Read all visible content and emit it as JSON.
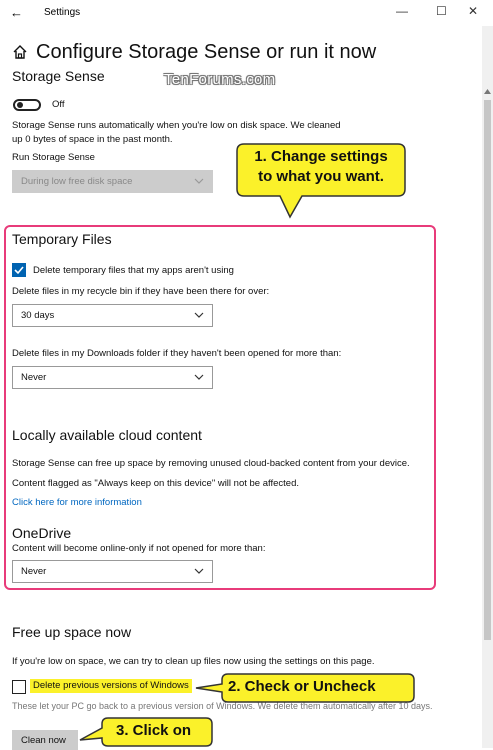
{
  "window": {
    "title": "Settings",
    "back_glyph": "←",
    "minimize_glyph": "—",
    "maximize_glyph": "☐",
    "close_glyph": "✕"
  },
  "header": {
    "title": "Configure Storage Sense or run it now",
    "watermark": "TenForums.com"
  },
  "storage_sense": {
    "heading": "Storage Sense",
    "toggle_state": "Off",
    "description": "Storage Sense runs automatically when you're low on disk space. We cleaned up 0 bytes of space in the past month.",
    "run_label": "Run Storage Sense",
    "run_value": "During low free disk space"
  },
  "temp_files": {
    "heading": "Temporary Files",
    "delete_temp_label": "Delete temporary files that my apps aren't using",
    "delete_temp_checked": true,
    "recycle_label": "Delete files in my recycle bin if they have been there for over:",
    "recycle_value": "30 days",
    "downloads_label": "Delete files in my Downloads folder if they haven't been opened for more than:",
    "downloads_value": "Never"
  },
  "cloud": {
    "heading": "Locally available cloud content",
    "desc1": "Storage Sense can free up space by removing unused cloud-backed content from your device.",
    "desc2": "Content flagged as \"Always keep on this device\" will not be affected.",
    "link": "Click here for more information",
    "onedrive_heading": "OneDrive",
    "onedrive_label": "Content will become online-only if not opened for more than:",
    "onedrive_value": "Never"
  },
  "free_up": {
    "heading": "Free up space now",
    "desc": "If you're low on space, we can try to clean up files now using the settings on this page.",
    "prev_versions_label": "Delete previous versions of Windows",
    "prev_versions_checked": false,
    "prev_versions_desc": "These let your PC go back to a previous version of Windows. We delete them automatically after 10 days.",
    "clean_button": "Clean now"
  },
  "callouts": {
    "c1_line1": "1. Change settings",
    "c1_line2": "to what you want.",
    "c2": "2. Check or Uncheck",
    "c3": "3. Click on"
  },
  "colors": {
    "accent": "#0063b1",
    "callout_yellow": "#fbf12a",
    "highlight_pink": "#e83b7a",
    "link": "#0067c0"
  }
}
